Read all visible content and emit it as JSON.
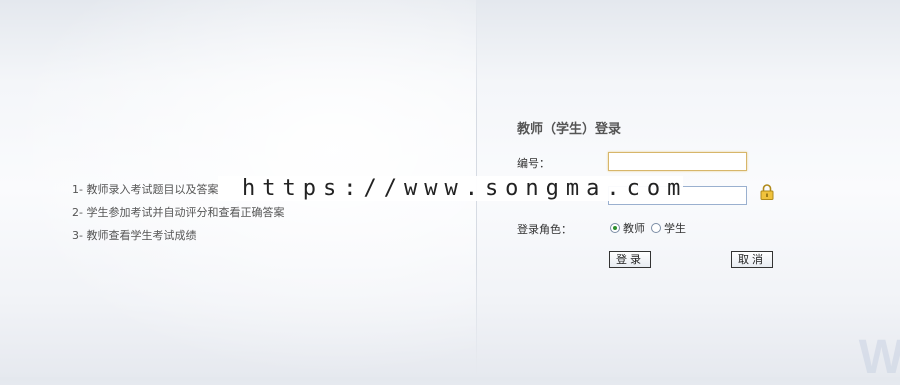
{
  "features": [
    "1- 教师录入考试题目以及答案",
    "2- 学生参加考试并自动评分和查看正确答案",
    "3- 教师查看学生考试成绩"
  ],
  "login": {
    "title": "教师（学生）登录",
    "id_label": "编号：",
    "id_value": "",
    "password_value": "",
    "role_label": "登录角色：",
    "roles": [
      {
        "label": "教师",
        "checked": true
      },
      {
        "label": "学生",
        "checked": false
      }
    ],
    "submit_label": "登录",
    "cancel_label": "取消"
  },
  "watermark_text": "https://www.songma.com",
  "corner_mark": "W",
  "icons": {
    "lock": "lock-icon"
  },
  "colors": {
    "accent": "#d7b66a",
    "input_border": "#9ab0cf"
  }
}
